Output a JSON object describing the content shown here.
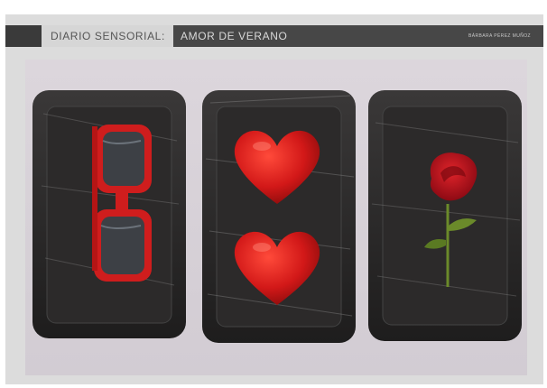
{
  "header": {
    "title_main": "DIARIO SENSORIAL:",
    "title_sub": "AMOR DE VERANO",
    "author": "BÁRBARA PÉREZ MUÑOZ"
  },
  "photo": {
    "trays": [
      {
        "name": "tray-sunglasses",
        "content": "red-sunglasses-icon"
      },
      {
        "name": "tray-hearts",
        "content": "red-hearts-icon"
      },
      {
        "name": "tray-rose",
        "content": "red-rose-icon"
      }
    ],
    "colors": {
      "tray": "#2a2828",
      "accent_red": "#d21818",
      "stem_green": "#6b8a2a",
      "header_dark": "#474747",
      "background": "#dcdcdc"
    }
  }
}
